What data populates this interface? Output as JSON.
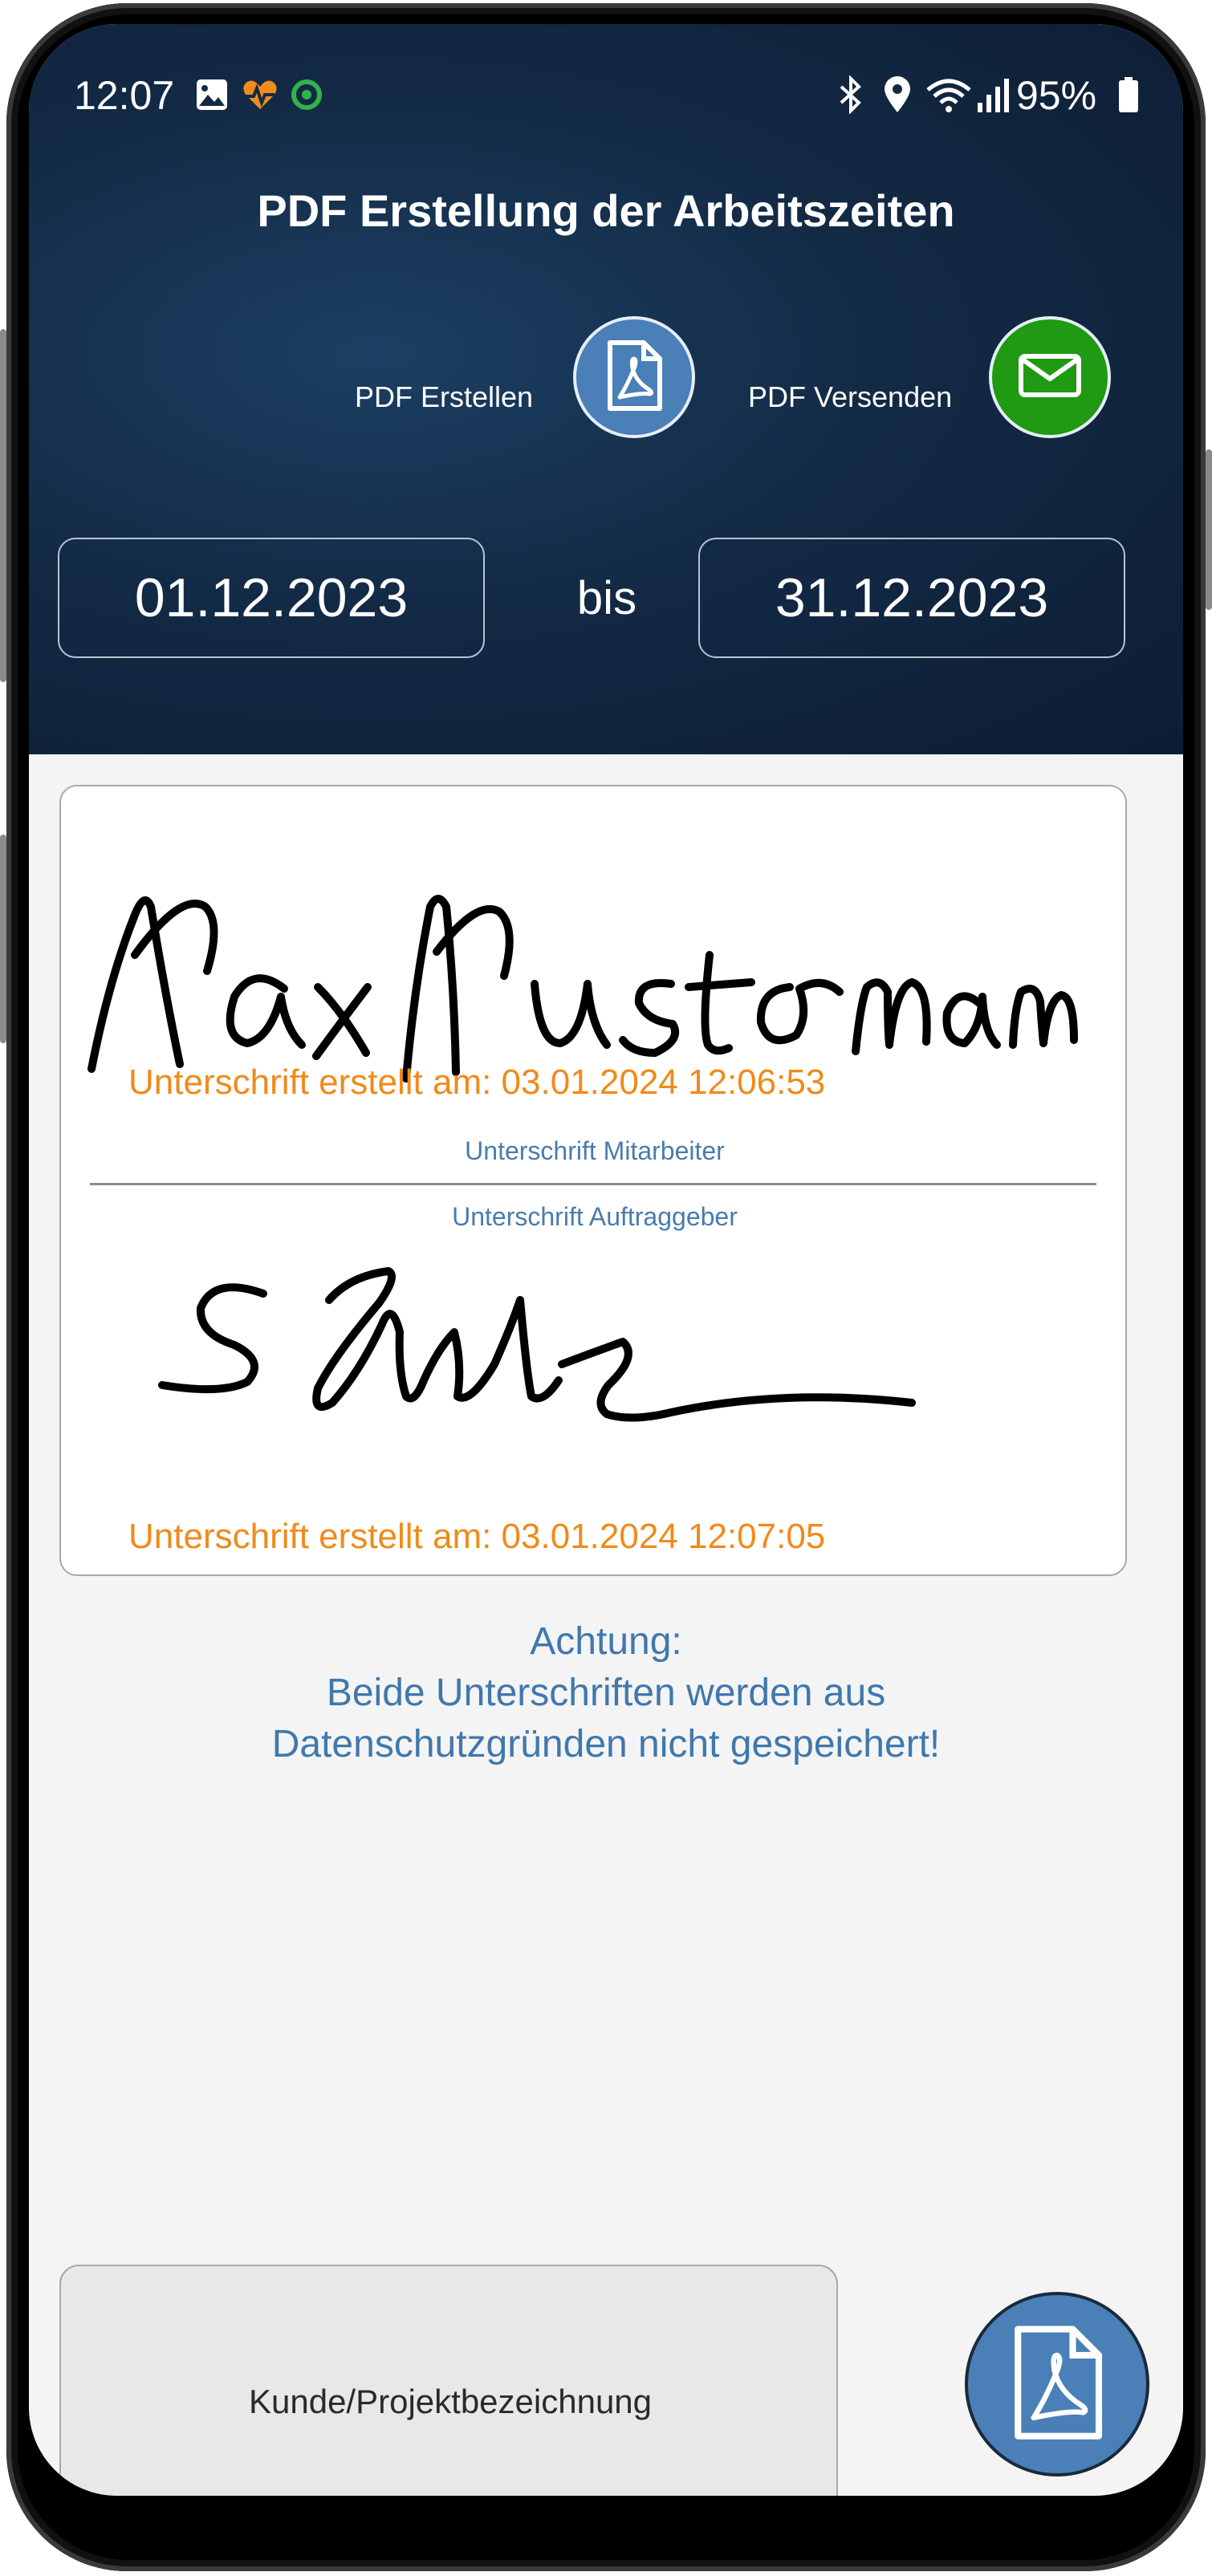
{
  "status_bar": {
    "time": "12:07",
    "battery": "95%",
    "icons": [
      "image-icon",
      "heart-rate-icon",
      "sync-icon",
      "bluetooth-icon",
      "location-icon",
      "wifi-icon",
      "signal-icon",
      "battery-icon"
    ]
  },
  "header": {
    "title": "PDF Erstellung der Arbeitszeiten",
    "create_label": "PDF Erstellen",
    "send_label": "PDF Versenden",
    "create_color": "#4a7fb8",
    "send_color": "#1f9a12"
  },
  "date_range": {
    "from": "01.12.2023",
    "separator": "bis",
    "to": "31.12.2023"
  },
  "signatures": {
    "employee_stamp": "Unterschrift erstellt am: 03.01.2024 12:06:53",
    "employee_caption": "Unterschrift Mitarbeiter",
    "client_caption": "Unterschrift Auftraggeber",
    "client_stamp": "Unterschrift erstellt am: 03.01.2024 12:07:05",
    "stamp_color": "#f08a1a"
  },
  "warning": {
    "line1": "Achtung:",
    "line2": "Beide Unterschriften werden aus",
    "line3": "Datenschutzgründen nicht gespeichert!"
  },
  "customer_field": {
    "placeholder": "Kunde/Projektbezeichnung"
  }
}
